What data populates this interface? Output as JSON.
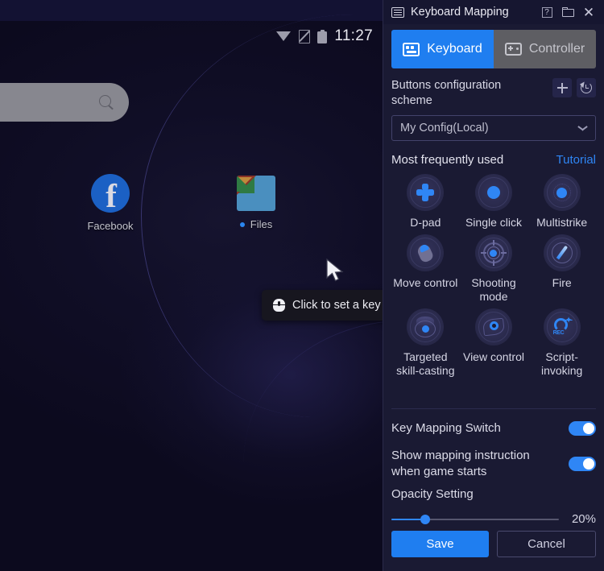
{
  "emulator": {
    "statusbar": {
      "time": "11:27",
      "wifi_icon": "wifi-icon",
      "signal_icon": "signal-off-icon",
      "battery_icon": "battery-icon"
    },
    "search": {
      "placeholder": "",
      "icon": "search-icon"
    },
    "apps": [
      {
        "label": "Facebook",
        "icon": "facebook-icon"
      },
      {
        "label": "Files",
        "icon": "files-icon",
        "has_dot": true
      }
    ],
    "tooltip": {
      "text": "Click to set a key",
      "icon": "mouse-icon"
    },
    "cursor": "pointer-cursor"
  },
  "panel": {
    "titlebar": {
      "title": "Keyboard Mapping",
      "icon": "keyboard-icon",
      "help_label": "?",
      "buttons": [
        "help-button",
        "folder-button",
        "close-button"
      ]
    },
    "tabs": [
      {
        "label": "Keyboard",
        "icon": "keyboard-icon",
        "active": true
      },
      {
        "label": "Controller",
        "icon": "gamepad-icon",
        "active": false
      }
    ],
    "scheme": {
      "label": "Buttons configuration scheme",
      "add_icon": "plus-icon",
      "history_icon": "history-icon",
      "selected": "My Config(Local)",
      "chevron": "chevron-down-icon"
    },
    "section": {
      "title": "Most frequently used",
      "link": "Tutorial"
    },
    "controls": [
      {
        "label": "D-pad",
        "icon": "dpad-icon"
      },
      {
        "label": "Single click",
        "icon": "single-click-icon"
      },
      {
        "label": "Multistrike",
        "icon": "multistrike-icon"
      },
      {
        "label": "Move control",
        "icon": "move-control-icon"
      },
      {
        "label": "Shooting mode",
        "icon": "shooting-mode-icon"
      },
      {
        "label": "Fire",
        "icon": "fire-icon"
      },
      {
        "label": "Targeted skill-casting",
        "icon": "targeted-skill-casting-icon"
      },
      {
        "label": "View control",
        "icon": "view-control-icon"
      },
      {
        "label": "Script-invoking",
        "icon": "script-invoking-icon"
      }
    ],
    "settings": {
      "key_mapping_switch": {
        "label": "Key Mapping Switch",
        "on": true
      },
      "show_instruction": {
        "label": "Show mapping instruction when game starts",
        "on": true
      },
      "opacity": {
        "label": "Opacity Setting",
        "value": "20%",
        "percent": 20
      }
    },
    "footer": {
      "save": "Save",
      "cancel": "Cancel"
    },
    "colors": {
      "accent": "#1f7ef0",
      "panel_bg": "#1a1a33",
      "tab_inactive": "#5e5e63",
      "link": "#2f86f5"
    }
  }
}
